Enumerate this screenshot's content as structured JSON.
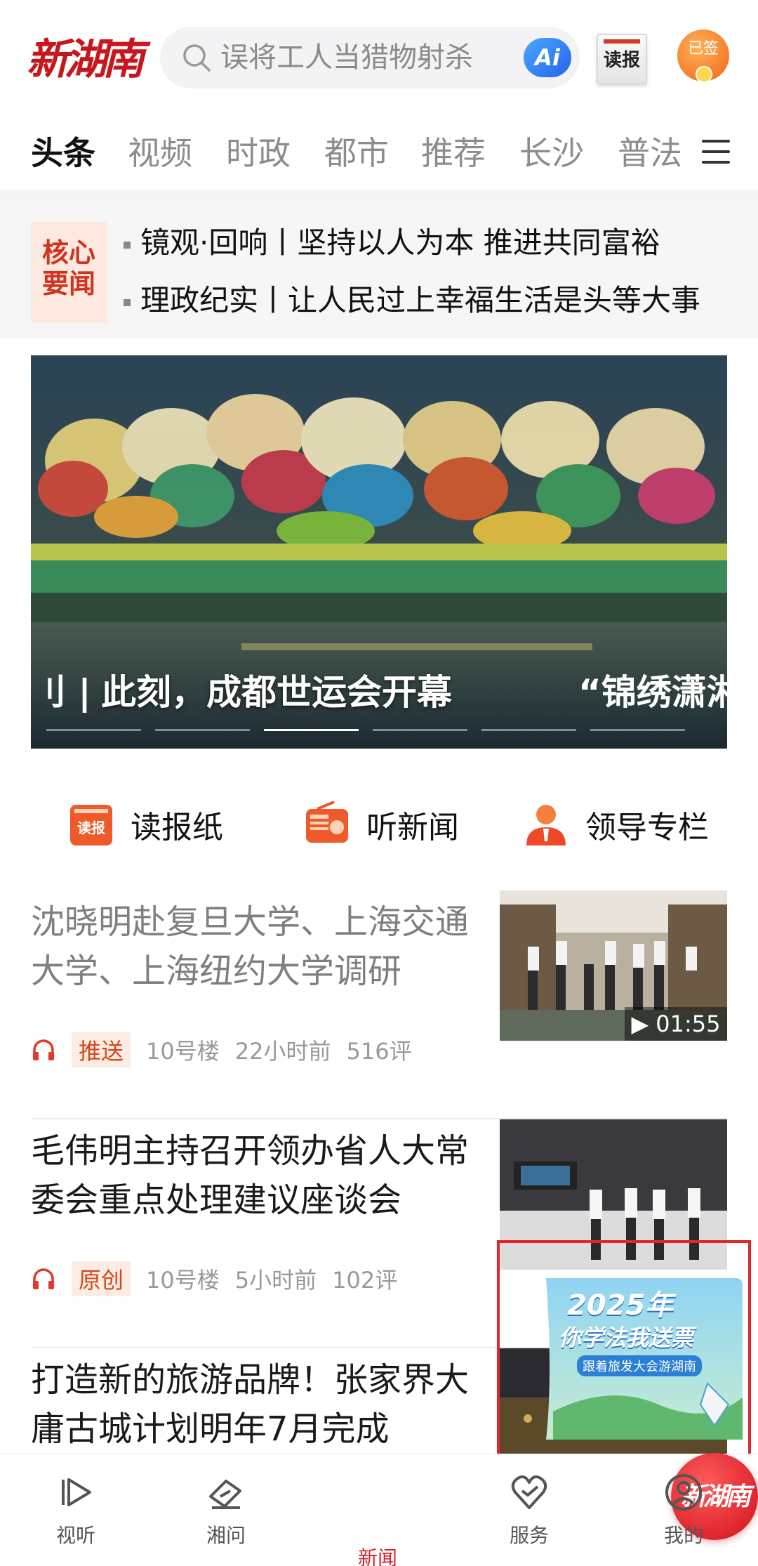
{
  "header": {
    "logo": "新湖南",
    "search_placeholder": "误将工人当猎物射杀",
    "ai_label": "Ai",
    "newspaper_label": "读报",
    "signin_label": "已签"
  },
  "tabs": [
    {
      "label": "头条",
      "active": true
    },
    {
      "label": "视频"
    },
    {
      "label": "时政"
    },
    {
      "label": "都市"
    },
    {
      "label": "推荐"
    },
    {
      "label": "长沙"
    },
    {
      "label": "普法"
    }
  ],
  "core_news": {
    "badge_line1": "核心",
    "badge_line2": "要闻",
    "items": [
      "镜观·回响丨坚持以人为本 推进共同富裕",
      "理政纪实丨让人民过上幸福生活是头等大事"
    ]
  },
  "banner": {
    "left_fragment": "刂 |",
    "caption": "此刻，成都世运会开幕",
    "next_caption": "“锦绣潇湘",
    "slide_count": 6,
    "active_slide": 3
  },
  "quick_entries": [
    {
      "label": "读报纸",
      "icon": "newspaper-icon",
      "icon_text": "读报"
    },
    {
      "label": "听新闻",
      "icon": "radio-icon"
    },
    {
      "label": "领导专栏",
      "icon": "leader-icon"
    }
  ],
  "feed": [
    {
      "title": "沈晓明赴复旦大学、上海交通大学、上海纽约大学调研",
      "tag": "推送",
      "source": "10号楼",
      "time": "22小时前",
      "comments": "516评",
      "duration": "▶ 01:55",
      "read": true
    },
    {
      "title": "毛伟明主持召开领办省人大常委会重点处理建议座谈会",
      "tag": "原创",
      "source": "10号楼",
      "time": "5小时前",
      "comments": "102评",
      "read": false
    },
    {
      "title": "打造新的旅游品牌！张家界大庸古城计划明年7月完成",
      "read": false
    }
  ],
  "promo": {
    "line1": "2025年",
    "line2": "你学法我送票",
    "line3": "跟着旅发大会游湖南"
  },
  "bottom_nav": [
    {
      "label": "视听",
      "icon": "play-icon"
    },
    {
      "label": "湘问",
      "icon": "pen-icon"
    },
    {
      "label": "新闻",
      "icon": "home-logo-icon",
      "active": true,
      "center_text": "新湖南"
    },
    {
      "label": "服务",
      "icon": "service-icon"
    },
    {
      "label": "我的",
      "icon": "profile-icon"
    }
  ],
  "colors": {
    "brand_red": "#d5232a",
    "tag_orange": "#d2481e"
  }
}
